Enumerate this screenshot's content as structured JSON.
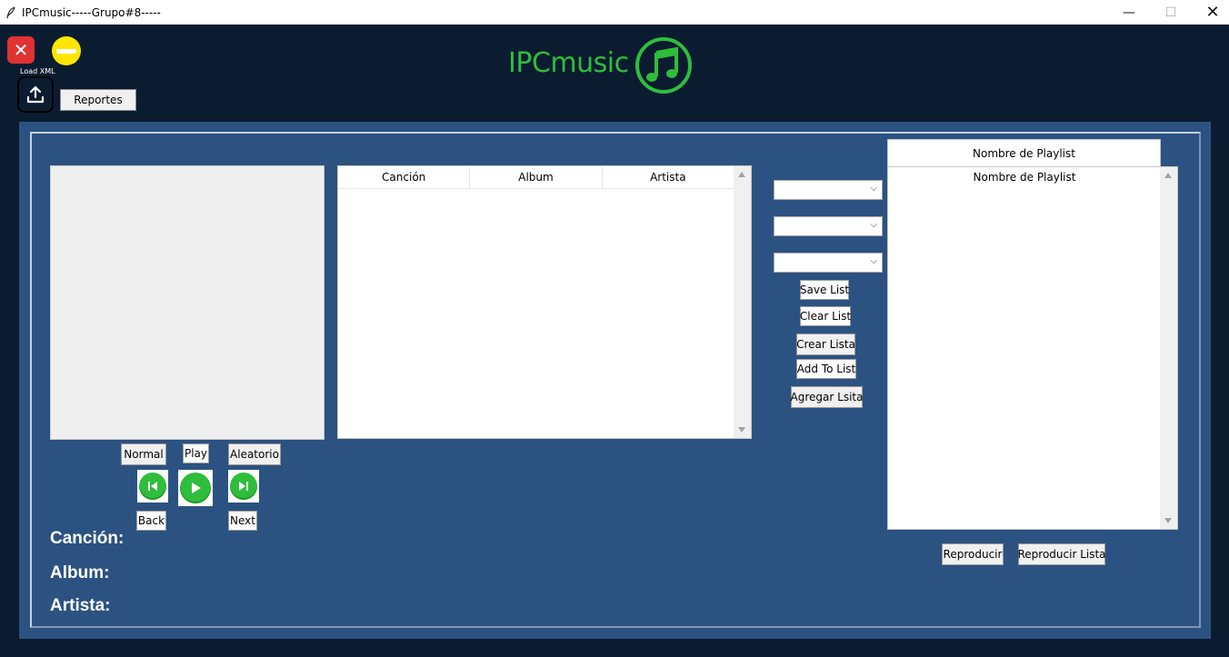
{
  "window": {
    "title": "IPCmusic-----Grupo#8-----",
    "minimize_glyph": "—",
    "maximize_glyph": "☐",
    "close_glyph": "✕"
  },
  "toolbar": {
    "close_app_glyph": "✕",
    "load_xml_label": "Load XML",
    "reportes_label": "Reportes"
  },
  "logo": {
    "text": "IPCmusic",
    "icon": "music-note-icon",
    "color": "#2fbd3c"
  },
  "songs_table": {
    "columns": [
      "Canción",
      "Album",
      "Artista"
    ],
    "rows": []
  },
  "filters": {
    "combo_values": [
      "",
      "",
      ""
    ],
    "chevron": "⌵"
  },
  "list_actions": {
    "save_list": "Save List",
    "clear_list": "Clear List",
    "crear_lista": "Crear Lista",
    "add_to_list": "Add To List",
    "agregar_lista": "Agregar Lsita"
  },
  "playlist": {
    "header": "Nombre de Playlist",
    "column_title": "Nombre de Playlist",
    "items": [],
    "reproducir": "Reproducir",
    "reproducir_lista": "Reproducir Lista"
  },
  "player": {
    "normal": "Normal",
    "play": "Play",
    "aleatorio": "Aleatorio",
    "back": "Back",
    "next": "Next",
    "accent": "#2fbd3c"
  },
  "now_playing": {
    "song_label": "Canción:",
    "album_label": "Album:",
    "artist_label": "Artista:"
  },
  "colors": {
    "background": "#0b1c30",
    "panel": "#2c5281"
  }
}
